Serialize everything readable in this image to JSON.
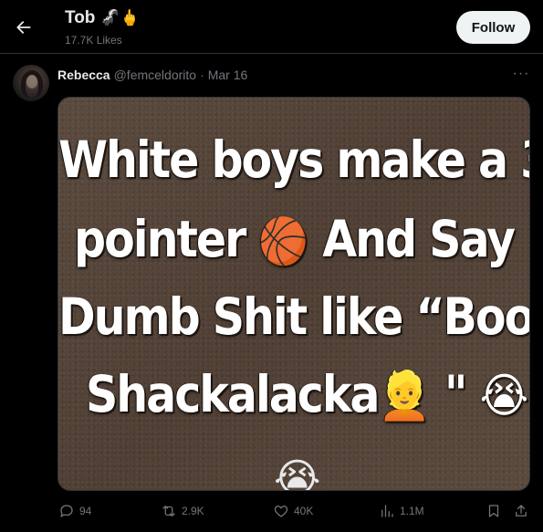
{
  "header": {
    "back_icon": "arrow-left-icon",
    "profile_name": "Tob",
    "name_emojis": "🦨🖕",
    "likes_count": "17.7K Likes",
    "follow_label": "Follow"
  },
  "tweet": {
    "author_name": "Rebecca",
    "author_handle": "@femceldorito",
    "separator": "·",
    "date": "Mar 16",
    "more_icon": "more-horizontal-icon",
    "more_glyph": "···",
    "meme": {
      "line1": "White boys make a 3",
      "line2_a": "pointer ",
      "line2_emoji": "🏀",
      "line2_b": " And Say",
      "line3": "Dumb Shit like “Boom",
      "line4_a": "Shackalacka",
      "line4_emoji1": "👱",
      "line4_mid": " \" ",
      "line4_emoji2": "😭",
      "line4_emoji3": "😭",
      "bottom_emoji": "😭"
    },
    "actions": {
      "replies": "94",
      "retweets": "2.9K",
      "likes": "40K",
      "views": "1.1M"
    }
  },
  "colors": {
    "background": "#000000",
    "primary_text": "#e7e9ea",
    "secondary_text": "#71767b",
    "follow_button_bg": "#eff3f4",
    "follow_button_text": "#0f1419",
    "meme_background": "#554438"
  }
}
